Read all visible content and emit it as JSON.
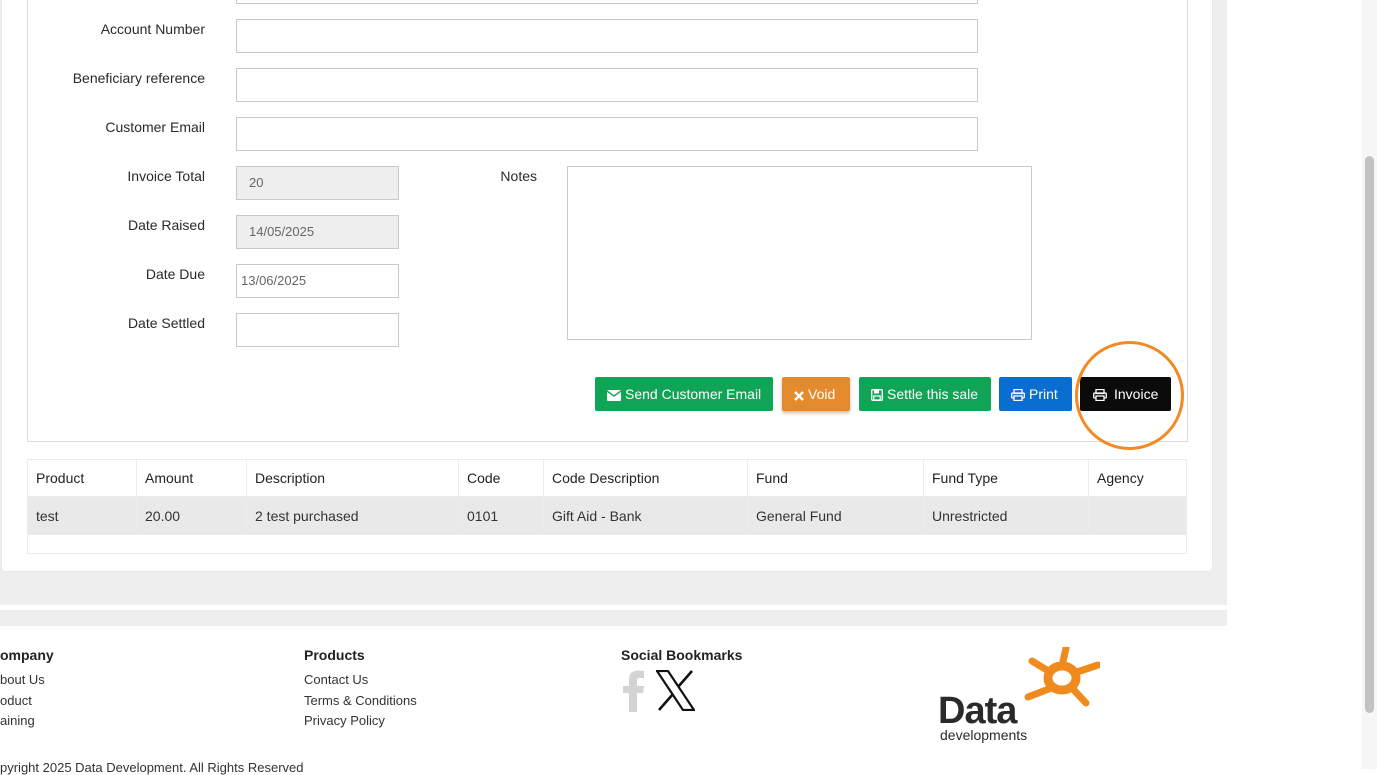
{
  "form": {
    "account_number_label": "Account Number",
    "beneficiary_reference_label": "Beneficiary reference",
    "customer_email_label": "Customer Email",
    "invoice_total_label": "Invoice Total",
    "invoice_total_value": "20",
    "date_raised_label": "Date Raised",
    "date_raised_value": "14/05/2025",
    "date_due_label": "Date Due",
    "date_due_value": "13/06/2025",
    "date_settled_label": "Date Settled",
    "notes_label": "Notes"
  },
  "actions": {
    "send_email": "Send Customer Email",
    "void": "Void",
    "settle": "Settle this sale",
    "print": "Print",
    "invoice": "Invoice"
  },
  "colors": {
    "green": "#10a556",
    "orange": "#e48b2d",
    "blue": "#0a6ed1",
    "black": "#0b0b0b",
    "highlight": "#f28a24"
  },
  "table": {
    "headers": [
      "Product",
      "Amount",
      "Description",
      "Code",
      "Code Description",
      "Fund",
      "Fund Type",
      "Agency"
    ],
    "rows": [
      [
        "test",
        "20.00",
        "2 test purchased",
        "0101",
        "Gift Aid - Bank",
        "General Fund",
        "Unrestricted",
        ""
      ]
    ]
  },
  "footer": {
    "company_title": "ompany",
    "company_links": [
      "bout Us",
      "oduct",
      "aining"
    ],
    "products_title": "Products",
    "products_links": [
      "Contact Us",
      "Terms & Conditions",
      "Privacy Policy"
    ],
    "social_title": "Social Bookmarks",
    "social_icons": [
      "facebook-icon",
      "x-icon"
    ],
    "logo_text": "Data",
    "logo_subtext": "developments",
    "copyright": "pyright 2025 Data Development. All Rights Reserved"
  }
}
